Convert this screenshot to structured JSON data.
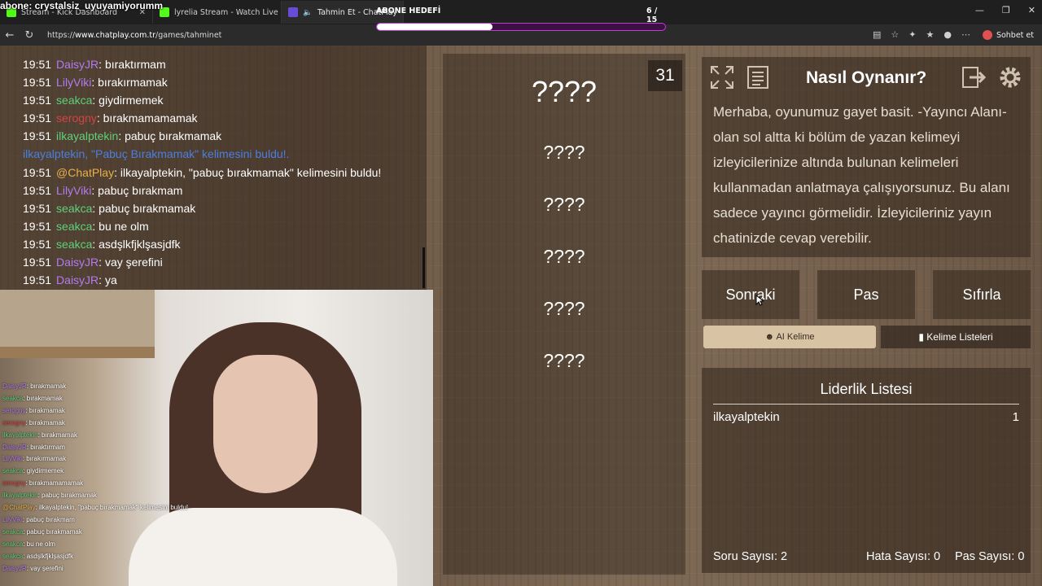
{
  "overlay": {
    "title": "abone: crystalsiz_uyuyamiyorumm"
  },
  "browser": {
    "tabs": [
      {
        "label": "Stream - Kick Dashboard",
        "icon": "kick-icon",
        "color": "#53fc18"
      },
      {
        "label": "lyrelia Stream - Watch Live on Kick",
        "icon": "kick-icon",
        "color": "#53fc18"
      },
      {
        "label": "Tahmin Et - ChatPlay",
        "icon": "chatplay-icon",
        "color": "#6a4bd8"
      }
    ],
    "url_prefix": "https://",
    "url_host": "www.chatplay.com.tr",
    "url_path": "/games/tahminet",
    "chat_button": "Sohbet et"
  },
  "goal": {
    "label": "ABONE HEDEFİ",
    "count": "6 / 15",
    "progress": 0.4
  },
  "chat": [
    {
      "time": "19:51",
      "user": "DaisyJR",
      "color": "#b37bf0",
      "message": ": bıraktırmam"
    },
    {
      "time": "19:51",
      "user": "LilyViki",
      "color": "#b37bf0",
      "message": ": bırakırmamak"
    },
    {
      "time": "19:51",
      "user": "seakca",
      "color": "#5fd07a",
      "message": ": giydirmemek"
    },
    {
      "time": "19:51",
      "user": "serogny",
      "color": "#d14545",
      "message": ": bırakmamamamak"
    },
    {
      "time": "19:51",
      "user": "ilkayalptekin",
      "color": "#5fd07a",
      "message": ": pabuç bırakmamak"
    },
    {
      "system": "ilkayalptekin, \"Pabuç Bırakmamak\" kelimesini buldu!."
    },
    {
      "time": "19:51",
      "user": "@ChatPlay",
      "color": "#e8b04a",
      "message": ": ilkayalptekin, \"pabuç bırakmamak\" kelimesini buldu!"
    },
    {
      "time": "19:51",
      "user": "LilyViki",
      "color": "#b37bf0",
      "message": ": pabuç bırakmam"
    },
    {
      "time": "19:51",
      "user": "seakca",
      "color": "#5fd07a",
      "message": ": pabuç bırakmamak"
    },
    {
      "time": "19:51",
      "user": "seakca",
      "color": "#5fd07a",
      "message": ": bu ne olm"
    },
    {
      "time": "19:51",
      "user": "seakca",
      "color": "#5fd07a",
      "message": ": asdşlkfjklşasjdfk"
    },
    {
      "time": "19:51",
      "user": "DaisyJR",
      "color": "#b37bf0",
      "message": ": vay şerefini"
    },
    {
      "time": "19:51",
      "user": "DaisyJR",
      "color": "#b37bf0",
      "message": ": ya"
    }
  ],
  "stream_chat": [
    {
      "user": "DaisyJR",
      "color": "#b37bf0",
      "message": ": bırakmamak"
    },
    {
      "user": "seakca",
      "color": "#5fd07a",
      "message": ": bırakmamak"
    },
    {
      "user": "serogny",
      "color": "#b37bf0",
      "message": ": bırakmamak"
    },
    {
      "user": "serogny",
      "color": "#d14545",
      "message": ": bırakmamak"
    },
    {
      "user": "ilkayalptekin",
      "color": "#5fd07a",
      "message": ": bırakmamak"
    },
    {
      "user": "DaisyJR",
      "color": "#b37bf0",
      "message": ": bıraktırmam"
    },
    {
      "user": "LilyViki",
      "color": "#b37bf0",
      "message": ": bırakırmamak"
    },
    {
      "user": "seakca",
      "color": "#5fd07a",
      "message": ": giydirmemek"
    },
    {
      "user": "serogny",
      "color": "#d14545",
      "message": ": bırakmamamamak"
    },
    {
      "user": "ilkayalptekin",
      "color": "#5fd07a",
      "message": ": pabuç bırakmamak"
    },
    {
      "user": "@ChatPlay",
      "color": "#e8b04a",
      "message": ": ilkayalptekin, \"pabuç bırakmamak\" kelimesini buldu!"
    },
    {
      "user": "LilyViki",
      "color": "#b37bf0",
      "message": ": pabuç bırakmam"
    },
    {
      "user": "seakca",
      "color": "#5fd07a",
      "message": ": pabuç bırakmamak"
    },
    {
      "user": "seakca",
      "color": "#5fd07a",
      "message": ": bu ne olm"
    },
    {
      "user": "seakca",
      "color": "#5fd07a",
      "message": ": asdşlkfjklşasjdfk"
    },
    {
      "user": "DaisyJR",
      "color": "#b37bf0",
      "message": ": vay şerefini"
    }
  ],
  "game": {
    "timer": "31",
    "words": [
      "????",
      "????",
      "????",
      "????",
      "????",
      "????"
    ],
    "how_title": "Nasıl Oynanır?",
    "how_text": "Merhaba, oyunumuz gayet basit. -Yayıncı Alanı- olan sol altta ki bölüm de yazan kelimeyi izleyicilerinize altında bulunan kelimeleri kullanmadan anlatmaya çalışıyorsunuz. Bu alanı sadece yayıncı görmelidir. İzleyicileriniz yayın chatinizde cevap verebilir.",
    "buttons": {
      "next": "Sonraki",
      "pass": "Pas",
      "reset": "Sıfırla"
    },
    "ai_word": "AI Kelime",
    "word_lists": "Kelime Listeleri",
    "leaderboard": {
      "title": "Liderlik Listesi",
      "entries": [
        {
          "name": "ilkayalptekin",
          "score": "1"
        }
      ]
    },
    "stats": {
      "questions": "Soru Sayısı: 2",
      "errors": "Hata Sayısı: 0",
      "passes": "Pas Sayısı: 0"
    }
  }
}
